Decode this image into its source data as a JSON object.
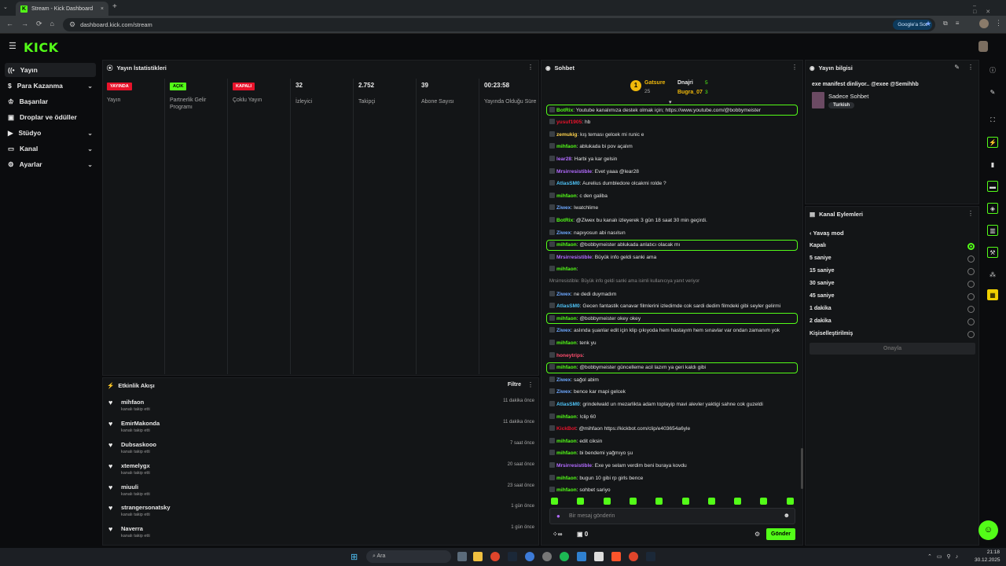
{
  "browser": {
    "tab_title": "Stream - Kick Dashboard",
    "url": "dashboard.kick.com/stream",
    "google_btn": "Google'a Sor"
  },
  "app": {
    "logo": "KICK"
  },
  "sidebar": {
    "items": [
      {
        "label": "Yayın",
        "icon": "broadcast-icon"
      },
      {
        "label": "Para Kazanma",
        "icon": "dollar-icon"
      },
      {
        "label": "Başarılar",
        "icon": "trophy-icon"
      },
      {
        "label": "Droplar ve ödüller",
        "icon": "gift-icon"
      },
      {
        "label": "Stüdyo",
        "icon": "camera-icon"
      },
      {
        "label": "Kanal",
        "icon": "channel-icon"
      },
      {
        "label": "Ayarlar",
        "icon": "gear-icon"
      }
    ]
  },
  "stats": {
    "title": "Yayın İstatistikleri",
    "cols": [
      {
        "badge": "YAYINDA",
        "badge_color": "#e8132b",
        "label": "Yayın"
      },
      {
        "badge": "AÇIK",
        "badge_color": "#53fc18",
        "label": "Partnerlik Gelir Programı"
      },
      {
        "badge": "KAPALI",
        "badge_color": "#e8132b",
        "label": "Çoklu Yayın"
      },
      {
        "value": "32",
        "label": "İzleyici"
      },
      {
        "value": "2.752",
        "label": "Takipçi"
      },
      {
        "value": "39",
        "label": "Abone Sayısı"
      },
      {
        "value": "00:23:58",
        "label": "Yayında Olduğu Süre"
      }
    ]
  },
  "activity": {
    "title": "Etkinlik Akışı",
    "filter": "Filtre",
    "items": [
      {
        "name": "mihfaon",
        "sub": "kanalı takip etti",
        "time": "11 dakika önce"
      },
      {
        "name": "EmirMakonda",
        "sub": "kanalı takip etti",
        "time": "11 dakika önce"
      },
      {
        "name": "Dubsaskooo",
        "sub": "kanalı takip etti",
        "time": "7 saat önce"
      },
      {
        "name": "xtemelygx",
        "sub": "kanalı takip etti",
        "time": "20 saat önce"
      },
      {
        "name": "miuuli",
        "sub": "kanalı takip etti",
        "time": "23 saat önce"
      },
      {
        "name": "strangersonatsky",
        "sub": "kanalı takip etti",
        "time": "1 gün önce"
      },
      {
        "name": "Naverra",
        "sub": "kanalı takip etti",
        "time": "1 gün önce"
      }
    ]
  },
  "chat": {
    "title": "Sohbet",
    "top_gifters": [
      {
        "name": "Gatsure",
        "count": "25"
      },
      {
        "name": "Dnajri",
        "count": "5"
      },
      {
        "name": "Bugra_07",
        "count": "3"
      }
    ],
    "messages": [
      {
        "user": "BotRix",
        "color": "#53fc18",
        "text": "Youtube kanalımıza destek olmak için; https://www.youtube.com/@bobbymeister",
        "hl": true
      },
      {
        "user": "yusuf1905",
        "color": "#e8132b",
        "text": "hb"
      },
      {
        "user": "zemukig",
        "color": "#ffd34d",
        "text": "kış teması gelcek mi runic e"
      },
      {
        "user": "mihfaon",
        "color": "#53fc18",
        "text": "ablukada bi pov açalım"
      },
      {
        "user": "lear28",
        "color": "#b36bff",
        "text": "Harbi ya kar gelsin"
      },
      {
        "user": "Mrsirresistible",
        "color": "#b36bff",
        "text": "Evet yaaa @lear28"
      },
      {
        "user": "AtlasSM0",
        "color": "#4fc3f7",
        "text": "Aurelius dumbledore olcakmi rolde ?"
      },
      {
        "user": "mihfaon",
        "color": "#53fc18",
        "text": "c den galiba"
      },
      {
        "user": "Ziwex",
        "color": "#6ea8ff",
        "text": "Iwatchlime"
      },
      {
        "user": "BotRix",
        "color": "#53fc18",
        "text": "@Ziwex bu kanalı izleyerek 3 gün 18 saat 30 min geçirdi."
      },
      {
        "user": "Ziwex",
        "color": "#6ea8ff",
        "text": "napıyosun abi nasılsın"
      },
      {
        "user": "mihfaon",
        "color": "#53fc18",
        "text": "@bobbymeister ablukada anlatıcı olacak mı",
        "hl": true
      },
      {
        "user": "Mrsirresistible",
        "color": "#b36bff",
        "text": "Büyük info geldi sanki ama"
      },
      {
        "user": "mihfaon",
        "color": "#53fc18",
        "text": ""
      },
      {
        "user": "",
        "color": "#888",
        "text": "Mrsirresistible: Büyük info geldi sanki ama  isimli kullanıcıya yanıt veriyor",
        "reply": true
      },
      {
        "user": "Ziwex",
        "color": "#6ea8ff",
        "text": "ne dedi duymadım"
      },
      {
        "user": "AtlasSM0",
        "color": "#4fc3f7",
        "text": "Gecen fantastik canavar filmlerini izledimde cok sardi dedim filmdeki gibi seyler gelirmi"
      },
      {
        "user": "mihfaon",
        "color": "#53fc18",
        "text": "@bobbymeister okey okey",
        "hl": true
      },
      {
        "user": "Ziwex",
        "color": "#6ea8ff",
        "text": "aslında şuanlar edit için klip çıkıyoda hem hastayım hem sınavlar var ondan zamanım yok"
      },
      {
        "user": "mihfaon",
        "color": "#53fc18",
        "text": "tenk yu"
      },
      {
        "user": "honeytrips",
        "color": "#ff4d6d",
        "text": ""
      },
      {
        "user": "mihfaon",
        "color": "#53fc18",
        "text": "@bobbymeister güncelleme acil lazım ya geri kaldı gibi",
        "hl": true
      },
      {
        "user": "Ziwex",
        "color": "#6ea8ff",
        "text": "sağol abim"
      },
      {
        "user": "Ziwex",
        "color": "#6ea8ff",
        "text": "bence kar mapi gelcek"
      },
      {
        "user": "AtlasSM0",
        "color": "#4fc3f7",
        "text": "grindelwald un mezarlikta adam toplayip mavi alevler yaktigi sahne cok guzeldi"
      },
      {
        "user": "mihfaon",
        "color": "#53fc18",
        "text": "!clip 60"
      },
      {
        "user": "KickBot",
        "color": "#e8132b",
        "text": "@mihfaon https://kickbot.com/clip/e403654a6yle"
      },
      {
        "user": "mihfaon",
        "color": "#53fc18",
        "text": "edit ciksin"
      },
      {
        "user": "mihfaon",
        "color": "#53fc18",
        "text": "bi bendemi yağmıyo şu"
      },
      {
        "user": "Mrsirresistible",
        "color": "#b36bff",
        "text": "Exe ye selam verdim beni buraya kovdu"
      },
      {
        "user": "mihfaon",
        "color": "#53fc18",
        "text": "bugun 10 gibi rp girls bence"
      },
      {
        "user": "mihfaon",
        "color": "#53fc18",
        "text": "sohbet sariyo"
      }
    ],
    "input_placeholder": "Bir mesaj gönderin",
    "infinity": "∞",
    "count": "0",
    "send": "Gönder"
  },
  "stream_info": {
    "title": "Yayın bilgisi",
    "stream_title": "exe manifest dinliyor.. @exee @Semihhb",
    "category": "Sadece Sohbet",
    "tag": "Turkish"
  },
  "channel_actions": {
    "title": "Kanal Eylemleri",
    "back": "Yavaş mod",
    "options": [
      "Kapalı",
      "5 saniye",
      "15 saniye",
      "30 saniye",
      "45 saniye",
      "1 dakika",
      "2 dakika",
      "Kişiselleştirilmiş"
    ],
    "selected": 0,
    "confirm": "Onayla"
  },
  "taskbar": {
    "search": "Ara",
    "time": "21:18",
    "date": "30.12.2025"
  }
}
